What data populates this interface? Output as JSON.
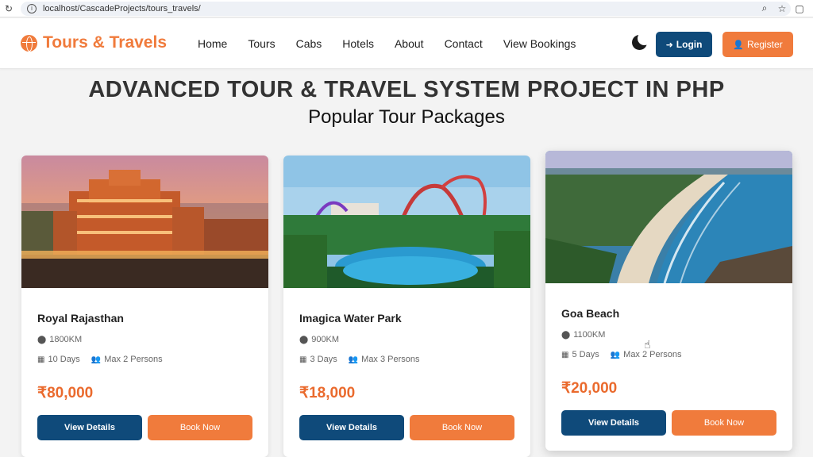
{
  "browser": {
    "url": "localhost/CascadeProjects/tours_travels/",
    "icons": [
      "reload-icon",
      "info-icon",
      "zoom-icon",
      "star-icon",
      "extensions-icon"
    ]
  },
  "navbar": {
    "brand": "Tours & Travels",
    "links": [
      "Home",
      "Tours",
      "Cabs",
      "Hotels",
      "About",
      "Contact",
      "View Bookings"
    ],
    "login_label": "Login",
    "register_label": "Register"
  },
  "page": {
    "headline": "ADVANCED TOUR & TRAVEL SYSTEM PROJECT IN PHP",
    "subheading": "Popular Tour Packages"
  },
  "packages": [
    {
      "title": "Royal Rajasthan",
      "distance": "1800KM",
      "duration": "10 Days",
      "persons": "Max 2 Persons",
      "price": "₹80,000",
      "details_label": "View Details",
      "book_label": "Book Now"
    },
    {
      "title": "Imagica Water Park",
      "distance": "900KM",
      "duration": "3 Days",
      "persons": "Max 3 Persons",
      "price": "₹18,000",
      "details_label": "View Details",
      "book_label": "Book Now"
    },
    {
      "title": "Goa Beach",
      "distance": "1100KM",
      "duration": "5 Days",
      "persons": "Max 2 Persons",
      "price": "₹20,000",
      "details_label": "View Details",
      "book_label": "Book Now"
    }
  ],
  "colors": {
    "brand_orange": "#f07b3c",
    "primary_blue": "#0f4a7a",
    "price_orange": "#ea6a2d"
  }
}
